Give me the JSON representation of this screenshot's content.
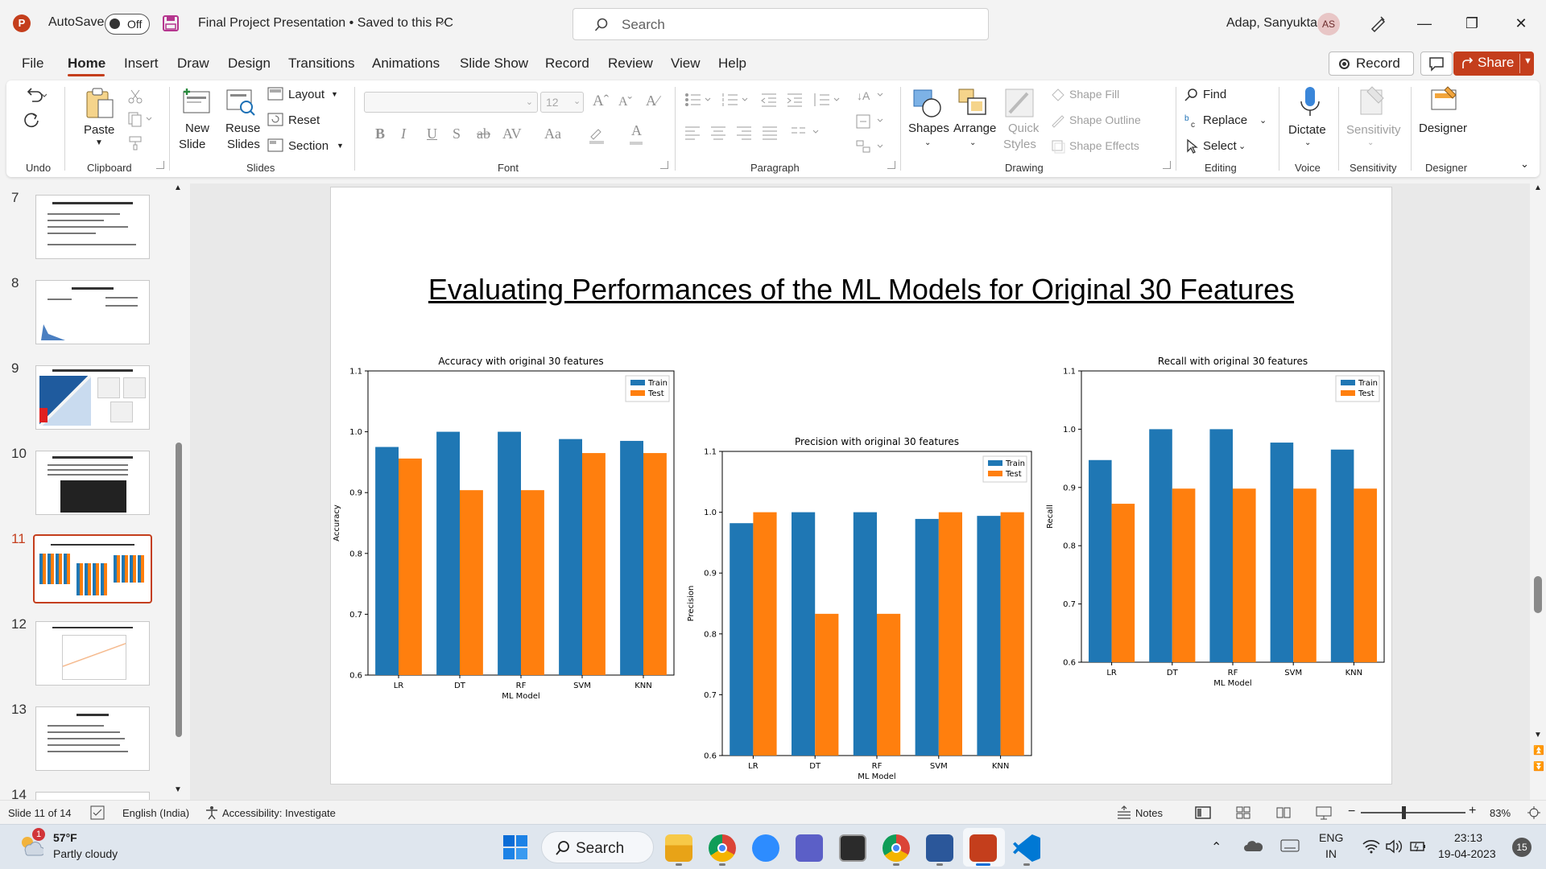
{
  "titlebar": {
    "app_logo": "P",
    "autosave_label": "AutoSave",
    "autosave_state": "Off",
    "document_title": "Final Project Presentation • Saved to this PC",
    "search_placeholder": "Search",
    "user_name": "Adap, Sanyukta",
    "user_initials": "AS"
  },
  "menu": {
    "tabs": [
      "File",
      "Home",
      "Insert",
      "Draw",
      "Design",
      "Transitions",
      "Animations",
      "Slide Show",
      "Record",
      "Review",
      "View",
      "Help"
    ],
    "active_tab": "Home",
    "record_label": "Record",
    "share_label": "Share"
  },
  "ribbon": {
    "groups": {
      "undo": "Undo",
      "clipboard": "Clipboard",
      "slides": "Slides",
      "font": "Font",
      "paragraph": "Paragraph",
      "drawing": "Drawing",
      "editing": "Editing",
      "voice": "Voice",
      "sensitivity": "Sensitivity",
      "designer": "Designer"
    },
    "paste": "Paste",
    "new_slide_1": "New",
    "new_slide_2": "Slide",
    "reuse_slides_1": "Reuse",
    "reuse_slides_2": "Slides",
    "layout": "Layout",
    "reset": "Reset",
    "section": "Section",
    "font_size": "12",
    "shapes": "Shapes",
    "arrange": "Arrange",
    "quick_styles_1": "Quick",
    "quick_styles_2": "Styles",
    "shape_fill": "Shape Fill",
    "shape_outline": "Shape Outline",
    "shape_effects": "Shape Effects",
    "find": "Find",
    "replace": "Replace",
    "select": "Select",
    "dictate": "Dictate",
    "sensitivity": "Sensitivity",
    "designer": "Designer"
  },
  "thumbnails": {
    "numbers": [
      "7",
      "8",
      "9",
      "10",
      "11",
      "12",
      "13",
      "14"
    ],
    "active": "11"
  },
  "slide": {
    "title": "Evaluating Performances of the ML Models for Original 30 Features"
  },
  "chart_data": [
    {
      "type": "bar",
      "title": "Accuracy with original 30 features",
      "xlabel": "ML Model",
      "ylabel": "Accuracy",
      "categories": [
        "LR",
        "DT",
        "RF",
        "SVM",
        "KNN"
      ],
      "ylim": [
        0.6,
        1.1
      ],
      "yticks": [
        "0.6",
        "0.7",
        "0.8",
        "0.9",
        "1.0",
        "1.1"
      ],
      "legend": "top-right",
      "series": [
        {
          "name": "Train",
          "color": "#1f77b4",
          "values": [
            0.975,
            1.0,
            1.0,
            0.988,
            0.985
          ]
        },
        {
          "name": "Test",
          "color": "#ff7f0e",
          "values": [
            0.956,
            0.904,
            0.904,
            0.965,
            0.965
          ]
        }
      ]
    },
    {
      "type": "bar",
      "title": "Precision with original 30 features",
      "xlabel": "ML Model",
      "ylabel": "Precision",
      "categories": [
        "LR",
        "DT",
        "RF",
        "SVM",
        "KNN"
      ],
      "ylim": [
        0.6,
        1.1
      ],
      "yticks": [
        "0.6",
        "0.7",
        "0.8",
        "0.9",
        "1.0",
        "1.1"
      ],
      "legend": "top-right",
      "series": [
        {
          "name": "Train",
          "color": "#1f77b4",
          "values": [
            0.982,
            1.0,
            1.0,
            0.989,
            0.994
          ]
        },
        {
          "name": "Test",
          "color": "#ff7f0e",
          "values": [
            1.0,
            0.833,
            0.833,
            1.0,
            1.0
          ]
        }
      ]
    },
    {
      "type": "bar",
      "title": "Recall with original 30 features",
      "xlabel": "ML Model",
      "ylabel": "Recall",
      "categories": [
        "LR",
        "DT",
        "RF",
        "SVM",
        "KNN"
      ],
      "ylim": [
        0.6,
        1.1
      ],
      "yticks": [
        "0.6",
        "0.7",
        "0.8",
        "0.9",
        "1.0",
        "1.1"
      ],
      "legend": "top-right",
      "series": [
        {
          "name": "Train",
          "color": "#1f77b4",
          "values": [
            0.947,
            1.0,
            1.0,
            0.977,
            0.965
          ]
        },
        {
          "name": "Test",
          "color": "#ff7f0e",
          "values": [
            0.872,
            0.898,
            0.898,
            0.898,
            0.898
          ]
        }
      ]
    }
  ],
  "statusbar": {
    "slide_counter": "Slide 11 of 14",
    "language": "English (India)",
    "accessibility": "Accessibility: Investigate",
    "notes": "Notes",
    "zoom": "83%"
  },
  "taskbar": {
    "weather_temp": "57°F",
    "weather_desc": "Partly cloudy",
    "weather_badge": "1",
    "search_label": "Search",
    "lang_1": "ENG",
    "lang_2": "IN",
    "time": "23:13",
    "date": "19-04-2023",
    "notification_count": "15"
  },
  "colors": {
    "accent": "#c43e1c",
    "train": "#1f77b4",
    "test": "#ff7f0e"
  }
}
